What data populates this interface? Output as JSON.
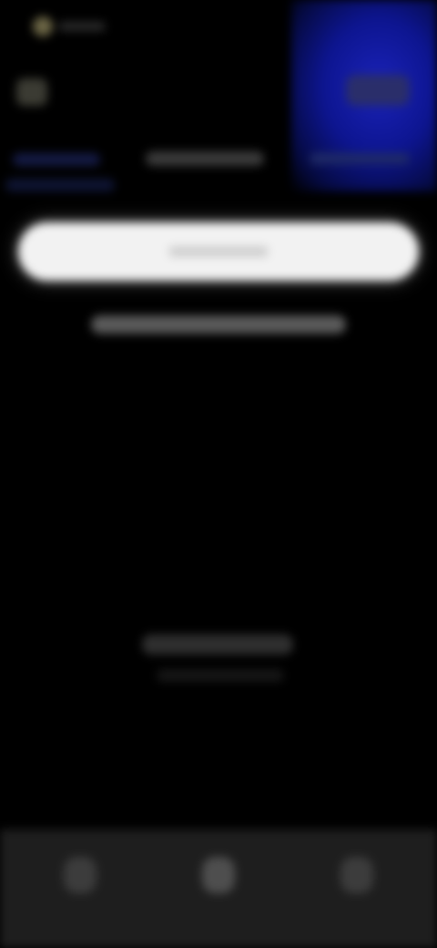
{
  "status_bar": {
    "time": "",
    "right_indicators": ""
  },
  "header": {
    "left_icon": "menu-icon",
    "left_label_1": "",
    "left_label_2": "",
    "center_label": "",
    "card_label": ""
  },
  "search": {
    "placeholder": ""
  },
  "subtitle": "",
  "empty_state": {
    "title": "",
    "caption": ""
  },
  "bottom_nav": {
    "items": [
      {
        "icon": "home-icon"
      },
      {
        "icon": "search-icon"
      },
      {
        "icon": "profile-icon"
      }
    ]
  },
  "colors": {
    "background": "#000000",
    "accent_blue": "#1a22b8",
    "search_bar": "#f2f2f2",
    "nav_bar": "#1e1e1e"
  }
}
